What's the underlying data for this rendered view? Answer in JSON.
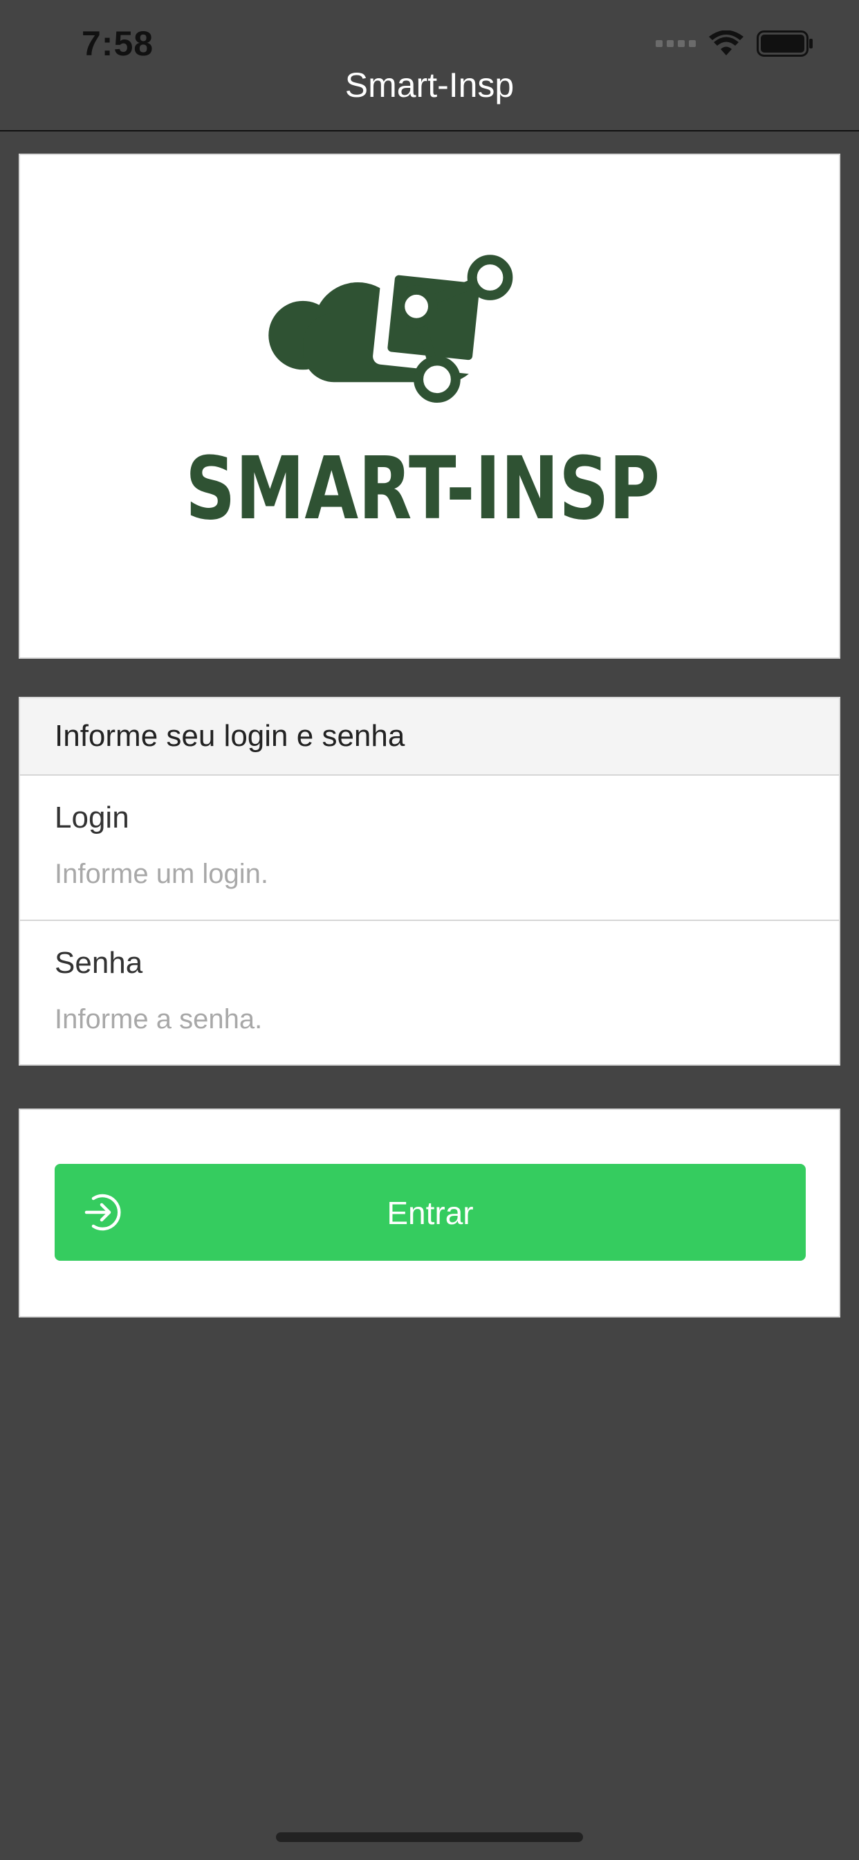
{
  "status_bar": {
    "time": "7:58"
  },
  "nav": {
    "title": "Smart-Insp"
  },
  "logo": {
    "text": "SMART-INSP",
    "color": "#2f5233"
  },
  "form": {
    "header": "Informe seu login e senha",
    "login": {
      "label": "Login",
      "placeholder": "Informe um login.",
      "value": ""
    },
    "password": {
      "label": "Senha",
      "placeholder": "Informe a senha.",
      "value": ""
    }
  },
  "actions": {
    "login_button_label": "Entrar",
    "login_button_icon": "login-arrow-circle-icon",
    "accent_color": "#35cc5f"
  },
  "colors": {
    "background": "#444444",
    "card": "#ffffff"
  }
}
